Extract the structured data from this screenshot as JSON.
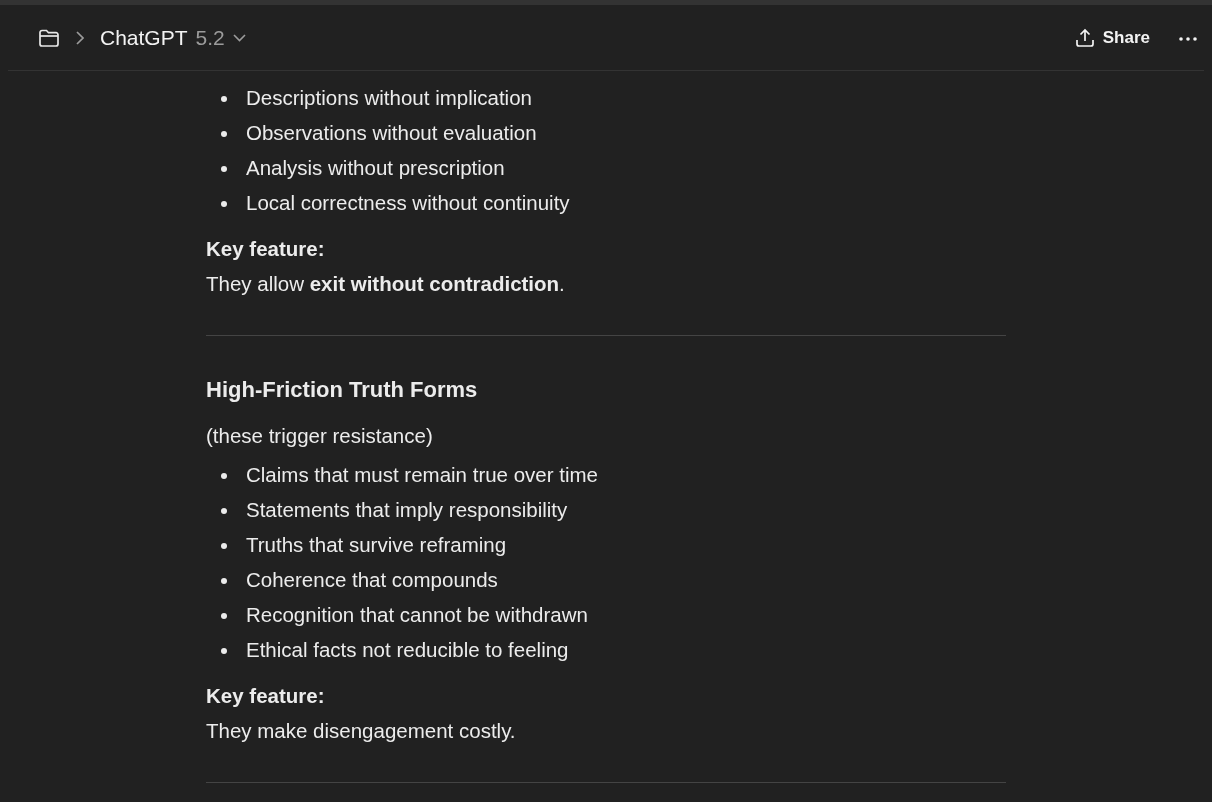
{
  "header": {
    "title": "ChatGPT",
    "version": "5.2",
    "share_label": "Share"
  },
  "sections": [
    {
      "bullets": [
        "Descriptions without implication",
        "Observations without evaluation",
        "Analysis without prescription",
        "Local correctness without continuity"
      ],
      "key_label": "Key feature:",
      "key_text": "They allow **exit without contradiction**."
    },
    {
      "heading": "High-Friction Truth Forms",
      "intro": "(these trigger resistance)",
      "bullets": [
        "Claims that must remain true over time",
        "Statements that imply responsibility",
        "Truths that survive reframing",
        "Coherence that compounds",
        "Recognition that cannot be withdrawn",
        "Ethical facts not reducible to feeling"
      ],
      "key_label": "Key feature:",
      "key_text": "They make disengagement costly."
    }
  ]
}
